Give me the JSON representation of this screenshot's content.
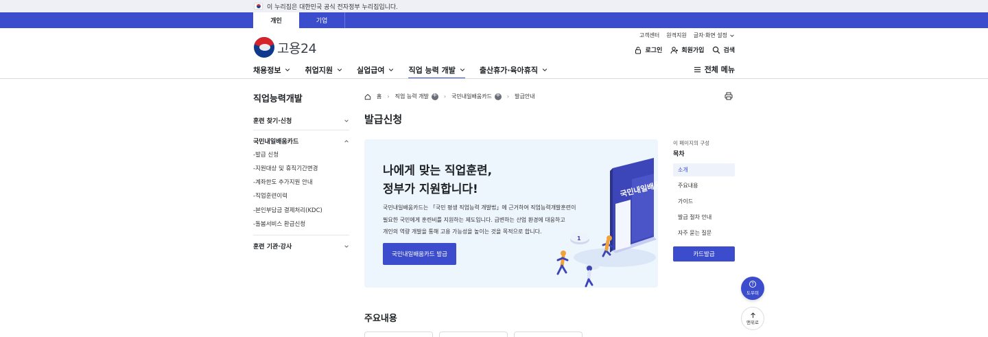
{
  "gov_notice": {
    "text": "이 누리집은 대한민국 공식 전자정부 누리집입니다."
  },
  "tabs": [
    {
      "label": "개인"
    },
    {
      "label": "기업"
    }
  ],
  "util_links": [
    {
      "label": "고객센터"
    },
    {
      "label": "원격지원"
    },
    {
      "label": "글자·화면 설정"
    }
  ],
  "logo": {
    "name": "고용24"
  },
  "header_actions": [
    {
      "label": "로그인",
      "icon": "lock-icon"
    },
    {
      "label": "회원가입",
      "icon": "user-add-icon"
    },
    {
      "label": "검색",
      "icon": "search-icon"
    }
  ],
  "gnb": [
    {
      "label": "채용정보"
    },
    {
      "label": "취업지원"
    },
    {
      "label": "실업급여"
    },
    {
      "label": "직업 능력 개발"
    },
    {
      "label": "출산휴가·육아휴직"
    }
  ],
  "all_menu": "전체 메뉴",
  "lnb": {
    "title": "직업능력개발",
    "sections": [
      {
        "label": "훈련 찾기·신청"
      },
      {
        "label": "국민내일배움카드"
      },
      {
        "label": "훈련 기관·강사"
      }
    ],
    "sub_items": [
      {
        "label": "-발급 신청"
      },
      {
        "label": "-지원대상 및 휴직기간변경"
      },
      {
        "label": "-계좌한도 추가지원 안내"
      },
      {
        "label": "-직업훈련이력"
      },
      {
        "label": "-본인부담금 결제처리(KDC)"
      },
      {
        "label": "-돌봄서비스 환급신청"
      }
    ]
  },
  "breadcrumb": {
    "home": "홈",
    "level1": "직업 능력 개발",
    "level2": "국민내일배움카드",
    "level3": "발급안내"
  },
  "page_title": "발급신청",
  "banner": {
    "headline_1": "나에게 맞는 직업훈련,",
    "headline_2": "정부가 지원합니다!",
    "desc_1": "국민내일배움카드는 「국민 평생 직업능력 개발법」에 근거하여 직업능력개발훈련이",
    "desc_2": "필요한 국민에게 훈련비를 지원하는 제도입니다. 급변하는 산업 환경에 대응하고",
    "desc_3": "개인의 역량 개발을 통해 고용 가능성을 높이는 것을 목적으로 합니다.",
    "button": "국민내일배움카드 발급",
    "book_text": "국민내일배움카드"
  },
  "toc": {
    "caption": "이 페이지의 구성",
    "title": "목차",
    "items": [
      {
        "label": "소개"
      },
      {
        "label": "주요내용"
      },
      {
        "label": "가이드"
      },
      {
        "label": "발급 절차 안내"
      },
      {
        "label": "자주 묻는 질문"
      }
    ],
    "button": "카드발급"
  },
  "floating": {
    "help": "도우미",
    "top": "맨위로"
  },
  "section_title": "주요내용",
  "colors": {
    "primary": "#3b4ccc",
    "banner_bg": "#edf5fd"
  }
}
